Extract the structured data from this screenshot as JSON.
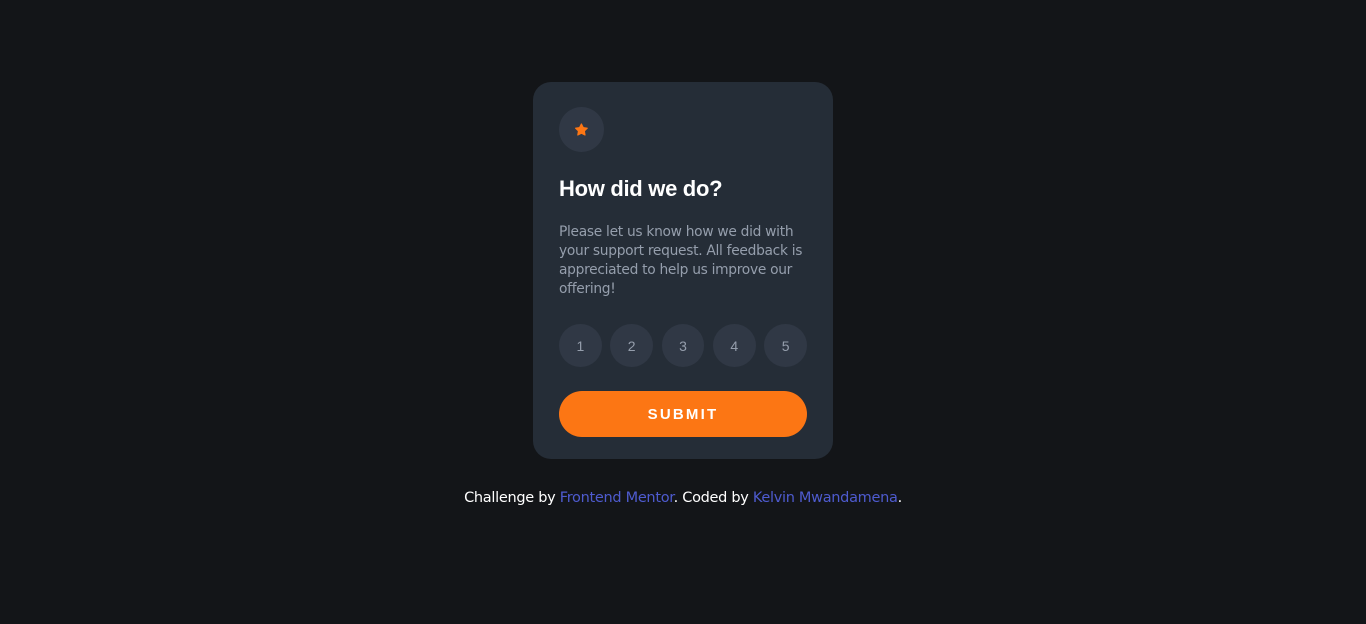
{
  "card": {
    "star_icon": "star-icon",
    "title": "How did we do?",
    "description": "Please let us know how we did with your support request. All feedback is appreciated to help us improve our offering!",
    "ratings": [
      "1",
      "2",
      "3",
      "4",
      "5"
    ],
    "submit_label": "SUBMIT"
  },
  "footer": {
    "prefix": "Challenge by ",
    "link1": "Frontend Mentor",
    "middle": ". Coded by ",
    "link2": "Kelvin Mwandamena",
    "suffix": "."
  },
  "colors": {
    "background": "#131518",
    "card": "#252d37",
    "accent": "#fc7614",
    "link": "#4e5bcf",
    "muted_text": "#959eac"
  }
}
